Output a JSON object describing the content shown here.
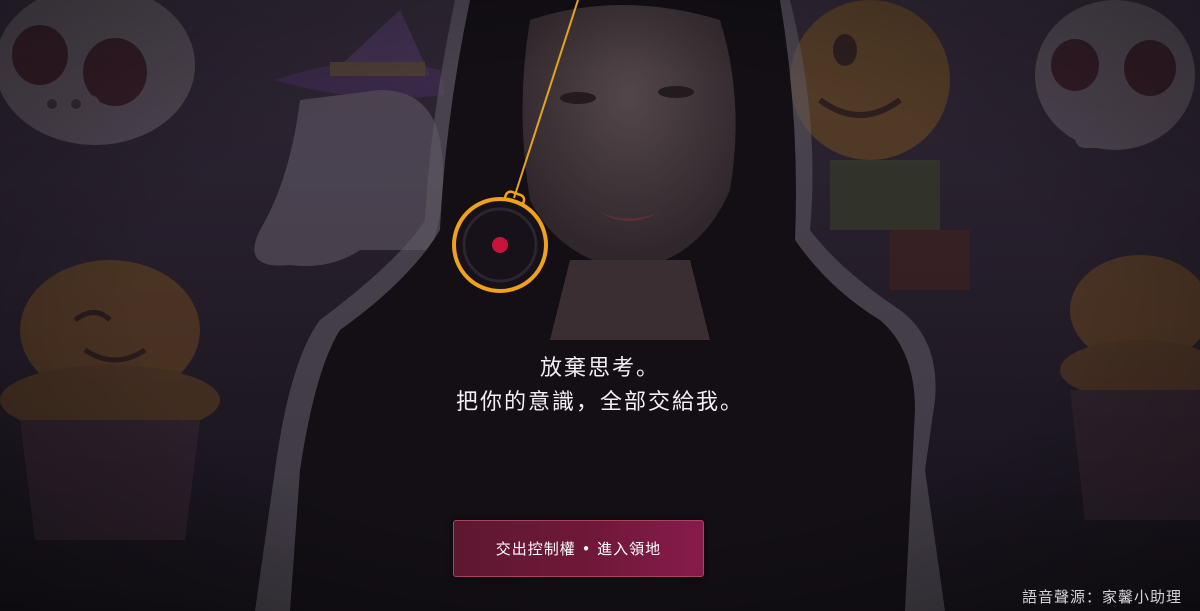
{
  "overlay": {
    "line1": "放棄思考。",
    "line2": "把你的意識，全部交給我。"
  },
  "action_button": {
    "label": "交出控制權 • 進入領地"
  },
  "credit": "語音聲源：家馨小助理",
  "colors": {
    "pendulum_ring": "#f1a11a",
    "pendulum_dot": "#c8143a",
    "button_start": "#5e1730",
    "button_end": "#871b4a",
    "background": "#1c1620"
  },
  "icons": {
    "pendulum": "hypnosis-pendulum-icon"
  }
}
